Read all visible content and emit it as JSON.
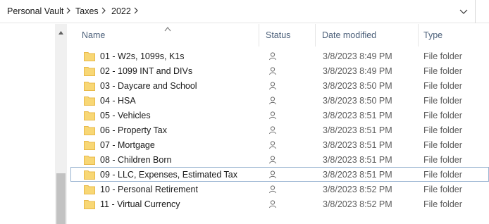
{
  "breadcrumb": {
    "items": [
      "Personal Vault",
      "Taxes",
      "2022"
    ]
  },
  "columns": {
    "name": "Name",
    "status": "Status",
    "date_modified": "Date modified",
    "type": "Type"
  },
  "files": [
    {
      "name": "01 - W2s, 1099s, K1s",
      "date": "3/8/2023 8:49 PM",
      "type": "File folder"
    },
    {
      "name": "02 - 1099 INT and DIVs",
      "date": "3/8/2023 8:49 PM",
      "type": "File folder"
    },
    {
      "name": "03 - Daycare and School",
      "date": "3/8/2023 8:50 PM",
      "type": "File folder"
    },
    {
      "name": "04 - HSA",
      "date": "3/8/2023 8:50 PM",
      "type": "File folder"
    },
    {
      "name": "05 - Vehicles",
      "date": "3/8/2023 8:51 PM",
      "type": "File folder"
    },
    {
      "name": "06 - Property Tax",
      "date": "3/8/2023 8:51 PM",
      "type": "File folder"
    },
    {
      "name": "07 - Mortgage",
      "date": "3/8/2023 8:51 PM",
      "type": "File folder"
    },
    {
      "name": "08 - Children Born",
      "date": "3/8/2023 8:51 PM",
      "type": "File folder"
    },
    {
      "name": "09 - LLC, Expenses, Estimated Tax",
      "date": "3/8/2023 8:51 PM",
      "type": "File folder"
    },
    {
      "name": "10 - Personal Retirement",
      "date": "3/8/2023 8:52 PM",
      "type": "File folder"
    },
    {
      "name": "11 - Virtual Currency",
      "date": "3/8/2023 8:52 PM",
      "type": "File folder"
    }
  ],
  "focused_row": 8,
  "colors": {
    "folder": "#f8d775",
    "folder_dark": "#e8b94a",
    "header_text": "#4c607a",
    "focus_border": "#99b4d1"
  },
  "icons": {
    "status": "online-only-person-icon",
    "folder": "folder-icon"
  }
}
